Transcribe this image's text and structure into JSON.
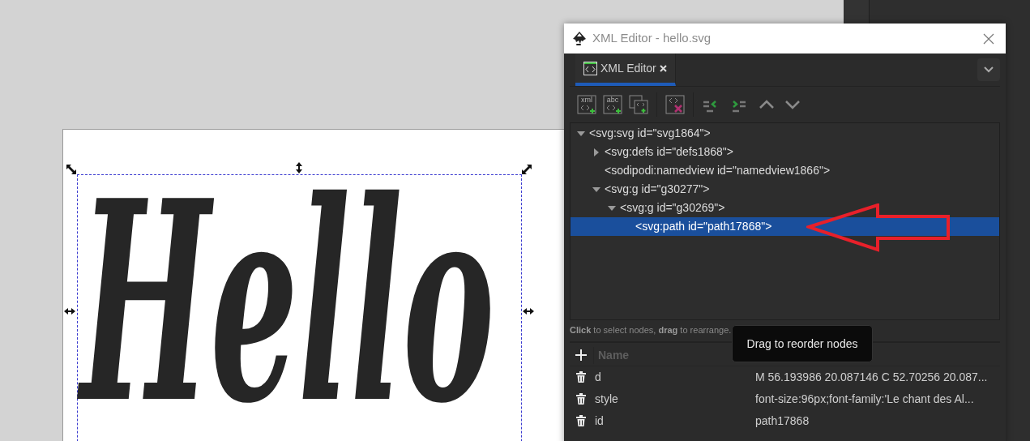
{
  "canvas": {
    "artwork_text": "Hello"
  },
  "window": {
    "title": "XML Editor - hello.svg"
  },
  "tabs": [
    {
      "label": "XML Editor",
      "selected": true
    }
  ],
  "toolbar": [
    {
      "kind": "new-element",
      "glyph": "xml"
    },
    {
      "kind": "new-text",
      "glyph": "abc"
    },
    {
      "kind": "duplicate"
    },
    {
      "kind": "separator"
    },
    {
      "kind": "delete"
    },
    {
      "kind": "separator"
    },
    {
      "kind": "unindent"
    },
    {
      "kind": "indent"
    },
    {
      "kind": "raise"
    },
    {
      "kind": "lower"
    }
  ],
  "tree": [
    {
      "label": "<svg:svg id=\"svg1864\">",
      "kind": "branch",
      "expanded": true,
      "selected": false,
      "children": [
        {
          "label": "<svg:defs id=\"defs1868\">",
          "kind": "branch",
          "expanded": false,
          "selected": false
        },
        {
          "label": "<sodipodi:namedview id=\"namedview1866\">",
          "kind": "leaf",
          "selected": false
        },
        {
          "label": "<svg:g id=\"g30277\">",
          "kind": "branch",
          "expanded": true,
          "selected": false,
          "children": [
            {
              "label": "<svg:g id=\"g30269\">",
              "kind": "branch",
              "expanded": true,
              "selected": false,
              "children": [
                {
                  "label": "<svg:path id=\"path17868\">",
                  "kind": "leaf",
                  "selected": true
                }
              ]
            }
          ]
        }
      ]
    }
  ],
  "hint": "**Click** to select nodes, **drag** to rearrange.",
  "attributes": {
    "columns": [
      "Name"
    ],
    "rows": [
      {
        "name": "d",
        "value": "M 56.193986 20.087146 C 52.70256 20.087..."
      },
      {
        "name": "style",
        "value": "font-size:96px;font-family:'Le chant des Al..."
      },
      {
        "name": "id",
        "value": "path17868"
      }
    ]
  },
  "tooltip": "Drag to reorder nodes"
}
